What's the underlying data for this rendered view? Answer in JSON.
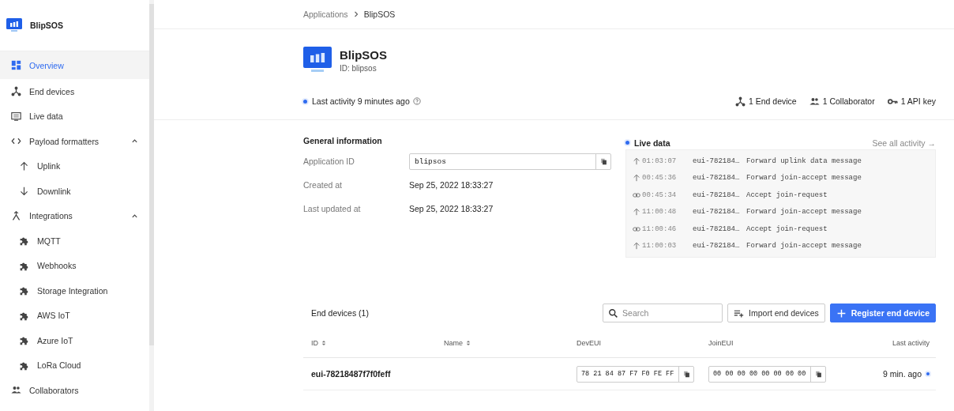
{
  "sidebar": {
    "app_name": "BlipSOS",
    "items": [
      {
        "label": "Overview",
        "selected": true
      },
      {
        "label": "End devices",
        "selected": false
      },
      {
        "label": "Live data",
        "selected": false
      },
      {
        "label": "Payload formatters",
        "selected": false,
        "expanded": true,
        "children": [
          {
            "label": "Uplink",
            "selected": false
          },
          {
            "label": "Downlink",
            "selected": false
          }
        ]
      },
      {
        "label": "Integrations",
        "selected": false,
        "expanded": true,
        "children": [
          {
            "label": "MQTT",
            "selected": false
          },
          {
            "label": "Webhooks",
            "selected": false
          },
          {
            "label": "Storage Integration",
            "selected": false
          },
          {
            "label": "AWS IoT",
            "selected": false
          },
          {
            "label": "Azure IoT",
            "selected": false
          },
          {
            "label": "LoRa Cloud",
            "selected": false
          }
        ]
      },
      {
        "label": "Collaborators",
        "selected": false
      }
    ]
  },
  "breadcrumb": [
    "Applications",
    "BlipSOS"
  ],
  "header": {
    "title": "BlipSOS",
    "id": "ID: blipsos",
    "last_activity": "Last activity 9 minutes ago",
    "stats": [
      "1 End device",
      "1 Collaborator",
      "1 API key"
    ]
  },
  "general": {
    "title": "General information",
    "application_id_label": "Application ID",
    "application_id": "blipsos",
    "rows": [
      {
        "label": "Created at",
        "value": "Sep 25, 2022 18:33:27"
      },
      {
        "label": "Last updated at",
        "value": "Sep 25, 2022 18:33:27"
      }
    ]
  },
  "live_data": {
    "title": "Live data",
    "link": "See all activity →",
    "events": [
      {
        "kind": "forward",
        "time": "01:03:07",
        "device": "eui-782184…",
        "message": "Forward uplink data message"
      },
      {
        "kind": "forward",
        "time": "00:45:36",
        "device": "eui-782184…",
        "message": "Forward join-accept message"
      },
      {
        "kind": "accept",
        "time": "00:45:34",
        "device": "eui-782184…",
        "message": "Accept join-request"
      },
      {
        "kind": "forward",
        "time": "11:00:48",
        "device": "eui-782184…",
        "message": "Forward join-accept message"
      },
      {
        "kind": "accept",
        "time": "11:00:46",
        "device": "eui-782184…",
        "message": "Accept join-request"
      },
      {
        "kind": "forward",
        "time": "11:00:03",
        "device": "eui-782184…",
        "message": "Forward join-accept message"
      }
    ]
  },
  "end_devices": {
    "title": "End devices (1)",
    "search": {
      "placeholder": "Search"
    },
    "import_button": "Import end devices",
    "register_button": "Register end device",
    "columns": [
      {
        "label": "ID",
        "sortable": true
      },
      {
        "label": "Name",
        "sortable": true
      },
      {
        "label": "DevEUI",
        "sortable": false
      },
      {
        "label": "JoinEUI",
        "sortable": false
      },
      {
        "label": "Last activity",
        "sortable": false
      }
    ],
    "rows": [
      {
        "id": "eui-78218487f7f0feff",
        "name": "",
        "dev_eui": "78 21 84 87 F7 F0 FE FF",
        "join_eui": "00 00 00 00 00 00 00 00",
        "last_activity": "9 min. ago",
        "online": true
      }
    ]
  }
}
